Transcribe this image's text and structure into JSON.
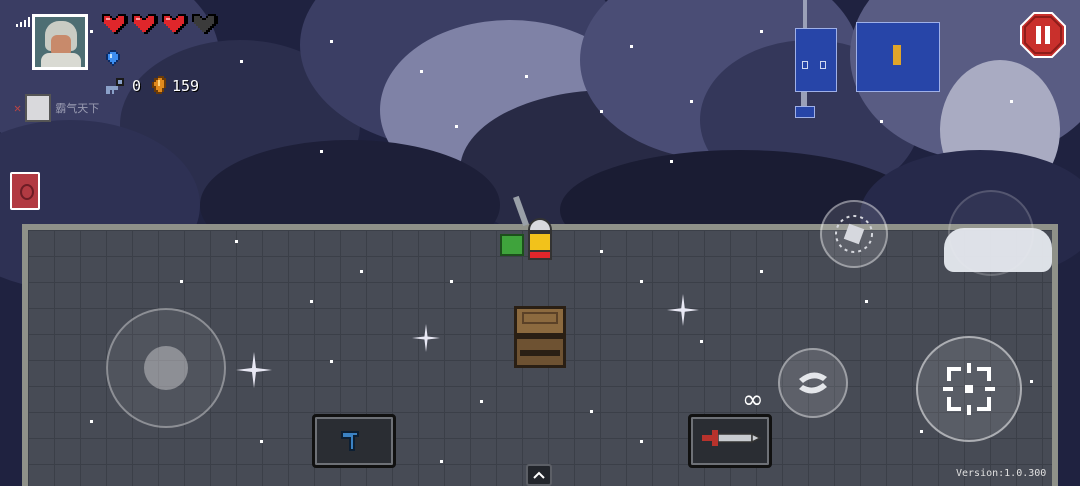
{
  "hud": {
    "hearts_full": 3,
    "hearts_total": 4,
    "keys_count": "0",
    "coins_count": "159",
    "buff_text": "霸气天下"
  },
  "minimap": {
    "rooms": [
      "current-room",
      "treasure-room"
    ]
  },
  "controls": {
    "weapon_ammo": "∞",
    "version_label": "Version:1.0.300"
  },
  "colors": {
    "pause_button": "#c9302c",
    "heart_red": "#e0262b",
    "floor": "#474b55",
    "sky": "#1f2240",
    "minimap_room": "#2745a8"
  },
  "icons": {
    "signal": "signal-icon",
    "pause": "pause-icon",
    "crosshair": "crosshair-icon",
    "swap": "weapon-swap-icon",
    "skill": "skill-icon",
    "expand": "chevron-up-icon"
  }
}
